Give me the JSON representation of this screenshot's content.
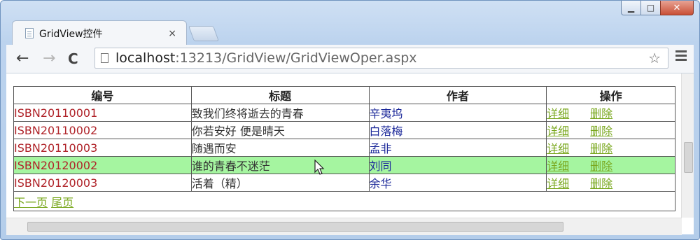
{
  "window": {
    "controls": {
      "minimize": "▁",
      "maximize": "□",
      "close": "✕"
    }
  },
  "tab": {
    "title": "GridView控件",
    "close": "×",
    "icon": "page-icon"
  },
  "toolbar": {
    "back": "←",
    "forward": "→",
    "reload": "C",
    "url_host": "localhost",
    "url_rest": ":13213/GridView/GridViewOper.aspx",
    "star": "☆"
  },
  "grid": {
    "headers": [
      "编号",
      "标题",
      "作者",
      "操作"
    ],
    "rows": [
      {
        "id": "ISBN20110001",
        "title": "致我们终将逝去的青春",
        "author": "辛夷坞",
        "detail": "详细",
        "delete": "删除",
        "selected": false
      },
      {
        "id": "ISBN20110002",
        "title": "你若安好 便是晴天",
        "author": "白落梅",
        "detail": "详细",
        "delete": "删除",
        "selected": false
      },
      {
        "id": "ISBN20110003",
        "title": "随遇而安",
        "author": "孟非",
        "detail": "详细",
        "delete": "删除",
        "selected": false
      },
      {
        "id": "ISBN20120002",
        "title": "谁的青春不迷茫",
        "author": "刘同",
        "detail": "详细",
        "delete": "删除",
        "selected": true
      },
      {
        "id": "ISBN20120003",
        "title": "活着（精）",
        "author": "余华",
        "detail": "详细",
        "delete": "删除",
        "selected": false
      }
    ],
    "pager": {
      "next": "下一页",
      "last": "尾页"
    }
  },
  "colors": {
    "id_text": "#b0242a",
    "author_text": "#1d2a9a",
    "link": "#7aa81f",
    "selected_row": "#a5f5a0"
  }
}
